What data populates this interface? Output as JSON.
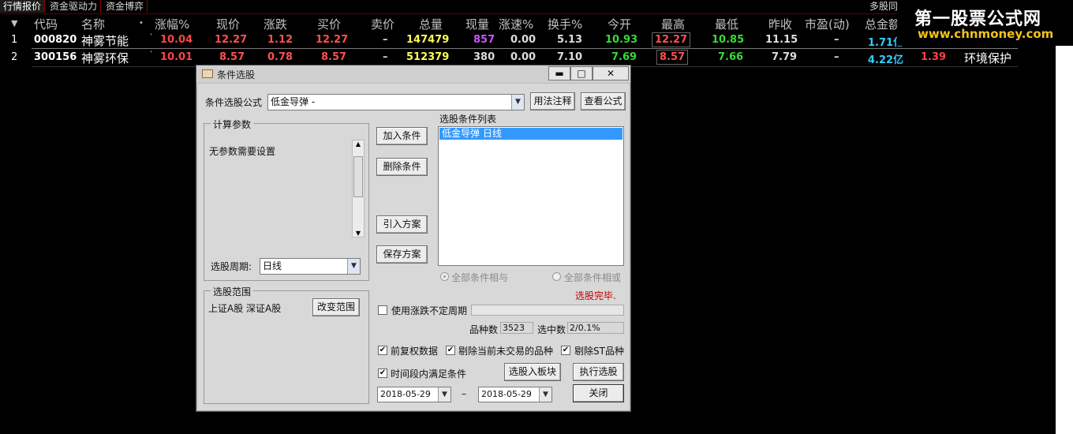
{
  "tabs": [
    "行情报价",
    "资金驱动力",
    "资金博弈"
  ],
  "right_tab": "多股同",
  "watermark": {
    "title": "第一股票公式网",
    "url": "www.chnmoney.com"
  },
  "columns": [
    "代码",
    "名称",
    "涨幅%",
    "现价",
    "涨跌",
    "买价",
    "卖价",
    "总量",
    "现量",
    "涨速%",
    "换手%",
    "今开",
    "最高",
    "最低",
    "昨收",
    "市盈(动)",
    "总金额"
  ],
  "rows": [
    {
      "idx": "1",
      "code": "000820",
      "name": "神雾节能",
      "change_pct": "10.04",
      "price": "12.27",
      "change": "1.12",
      "bid": "12.27",
      "ask": "–",
      "volume": "147479",
      "cur_vol": "857",
      "speed": "0.00",
      "turnover": "5.13",
      "open": "10.93",
      "high": "12.27",
      "low": "10.85",
      "prev_close": "11.15",
      "pe": "–",
      "amount": "1.71亿"
    },
    {
      "idx": "2",
      "code": "300156",
      "name": "神雾环保",
      "change_pct": "10.01",
      "price": "8.57",
      "change": "0.78",
      "bid": "8.57",
      "ask": "–",
      "volume": "512379",
      "cur_vol": "380",
      "speed": "0.00",
      "turnover": "7.10",
      "open": "7.69",
      "high": "8.57",
      "low": "7.66",
      "prev_close": "7.79",
      "pe": "–",
      "amount": "4.22亿",
      "extra1": "1.39",
      "extra2": "环境保护"
    }
  ],
  "dialog": {
    "title": "条件选股",
    "formula_label": "条件选股公式",
    "formula_value": "低金导弹      -",
    "usage_button": "用法注释",
    "view_button": "查看公式",
    "params_group": "计算参数",
    "params_text": "无参数需要设置",
    "add_button": "加入条件",
    "delete_button": "删除条件",
    "import_button": "引入方案",
    "save_button": "保存方案",
    "condition_list_label": "选股条件列表",
    "conditions": [
      "低金导弹   日线"
    ],
    "period_label": "选股周期:",
    "period_value": "日线",
    "radio_and": "全部条件相与",
    "radio_or": "全部条件相或",
    "status": "选股完毕.",
    "range_group": "选股范围",
    "range_text": "上证A股 深证A股",
    "change_range_button": "改变范围",
    "use_uncertain_label": "使用涨跌不定周期",
    "count_label": "品种数",
    "count_value": "3523",
    "selected_label": "选中数",
    "selected_value": "2/0.1%",
    "chk_prerights": "前复权数据",
    "chk_exclude_untraded": "剔除当前未交易的品种",
    "chk_exclude_st": "剔除ST品种",
    "chk_period_satisfy": "时间段内满足条件",
    "to_block_button": "选股入板块",
    "execute_button": "执行选股",
    "date_from": "2018-05-29",
    "date_sep": "–",
    "date_to": "2018-05-29",
    "close_button": "关闭"
  },
  "colors": {
    "up": "#ff4444",
    "price": "#ff5050",
    "volume": "#ffff55",
    "purple": "#cc55ff",
    "green": "#33dd33",
    "cyan": "#33ccff"
  }
}
